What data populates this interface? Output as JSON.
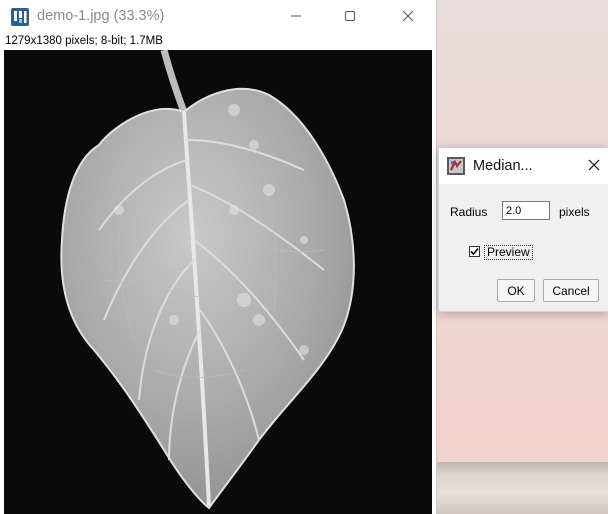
{
  "image_window": {
    "title": "demo-1.jpg (33.3%)",
    "info": "1279x1380 pixels; 8-bit; 1.7MB"
  },
  "dialog": {
    "title": "Median...",
    "radius_label": "Radius",
    "radius_value": "2.0",
    "units_label": "pixels",
    "preview_label": "Preview",
    "preview_checked": true,
    "ok_label": "OK",
    "cancel_label": "Cancel"
  },
  "icons": {
    "app": "imagej-icon",
    "minimize": "minimize-icon",
    "maximize": "maximize-icon",
    "close": "close-icon",
    "check": "check-icon"
  }
}
